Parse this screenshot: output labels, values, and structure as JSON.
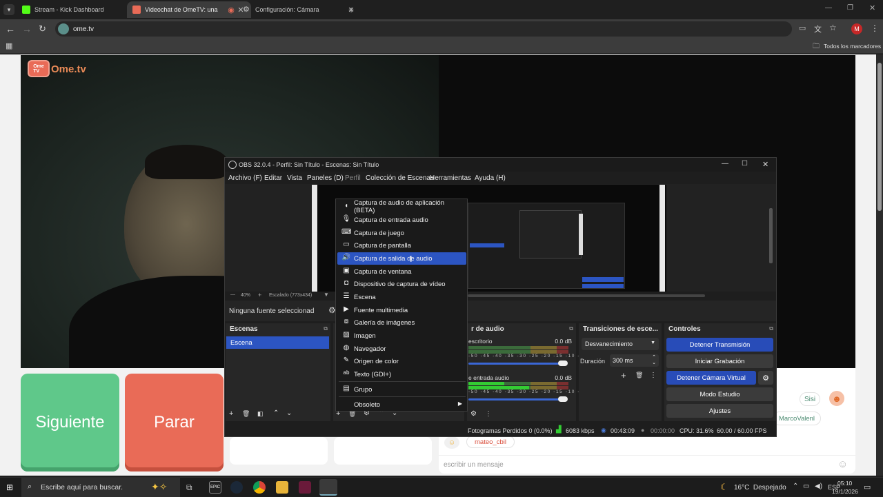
{
  "browser": {
    "tabs": [
      {
        "title": "Stream - Kick Dashboard",
        "favicon_color": "#53fc18"
      },
      {
        "title": "Videochat de OmeTV: una",
        "favicon_color": "#e96b57"
      },
      {
        "title": "Configuración: Cámara",
        "favicon_color": "#bbbbbb"
      }
    ],
    "url": "ome.tv",
    "bookmarks_label": "Todos los marcadores",
    "profile_initial": "M"
  },
  "page": {
    "logo_text": "Ome.tv",
    "next_button": "Siguiente",
    "stop_button": "Parar",
    "chat_message_1": "Sisi",
    "chat_user_1": "MarcoValenl",
    "chat_user_2": "mateo_cbil",
    "chat_placeholder": "escribir un mensaje"
  },
  "obs": {
    "window_title": "OBS 32.0.4 - Perfil: Sin Título - Escenas: Sin Título",
    "menu": [
      "Archivo (F)",
      "Editar",
      "Vista",
      "Paneles (D)",
      "Perfil",
      "Colección de Escenas",
      "Herramientas",
      "Ayuda (H)"
    ],
    "zoom": "40%",
    "scaling": "Escalado (773x434)",
    "no_source": "Ninguna fuente seleccionad",
    "scenes_header": "Escenas",
    "scene_item": "Escena",
    "audio_header": "r de audio",
    "audio_track_1": "escritorio",
    "audio_track_1_db": "0.0 dB",
    "audio_track_2": "e entrada audio",
    "audio_track_2_db": "0.0 dB",
    "meter_scale": "-50 -45 -40 -35 -30 -25 -20 -15 -10 -5 0",
    "transitions_header": "Transiciones de esce...",
    "transition": "Desvanecimiento",
    "duration_label": "Duración",
    "duration_value": "300 ms",
    "controls_header": "Controles",
    "controls": [
      "Detener Transmisión",
      "Iniciar Grabación",
      "Detener Cámara Virtual",
      "Modo Estudio",
      "Ajustes"
    ],
    "status": {
      "dropped_frames": "Fotogramas Perdidos 0 (0.0%)",
      "bitrate": "6083 kbps",
      "stream_time": "00:43:09",
      "rec_time": "00:00:00",
      "cpu": "CPU: 31.6%",
      "fps": "60.00 / 60.00 FPS"
    },
    "context_menu": [
      {
        "label": "Captura de audio de aplicación (BETA)",
        "icon": "app-audio-icon"
      },
      {
        "label": "Captura de entrada audio",
        "icon": "microphone-icon"
      },
      {
        "label": "Captura de juego",
        "icon": "gamepad-icon"
      },
      {
        "label": "Captura de pantalla",
        "icon": "monitor-icon"
      },
      {
        "label": "Captura de salida de audio",
        "icon": "speaker-icon",
        "selected": true
      },
      {
        "label": "Captura de ventana",
        "icon": "window-icon"
      },
      {
        "label": "Dispositivo de captura de vídeo",
        "icon": "camera-icon"
      },
      {
        "label": "Escena",
        "icon": "list-icon"
      },
      {
        "label": "Fuente multimedia",
        "icon": "play-icon"
      },
      {
        "label": "Galería de imágenes",
        "icon": "slideshow-icon"
      },
      {
        "label": "Imagen",
        "icon": "image-icon"
      },
      {
        "label": "Navegador",
        "icon": "globe-icon"
      },
      {
        "label": "Origen de color",
        "icon": "brush-icon"
      },
      {
        "label": "Texto (GDI+)",
        "icon": "text-icon"
      },
      {
        "label": "Grupo",
        "icon": "folder-icon"
      },
      {
        "label": "Obsoleto",
        "icon": "submenu-arrow-icon"
      }
    ]
  },
  "taskbar": {
    "search_placeholder": "Escribe aquí para buscar.",
    "weather": "16°C  Despejado",
    "language": "ESP",
    "time": "05:10",
    "date": "19/1/2026"
  },
  "colors": {
    "accent_blue": "#284cb8",
    "ometv_green": "#5fc88a",
    "ometv_red": "#e96b57"
  }
}
